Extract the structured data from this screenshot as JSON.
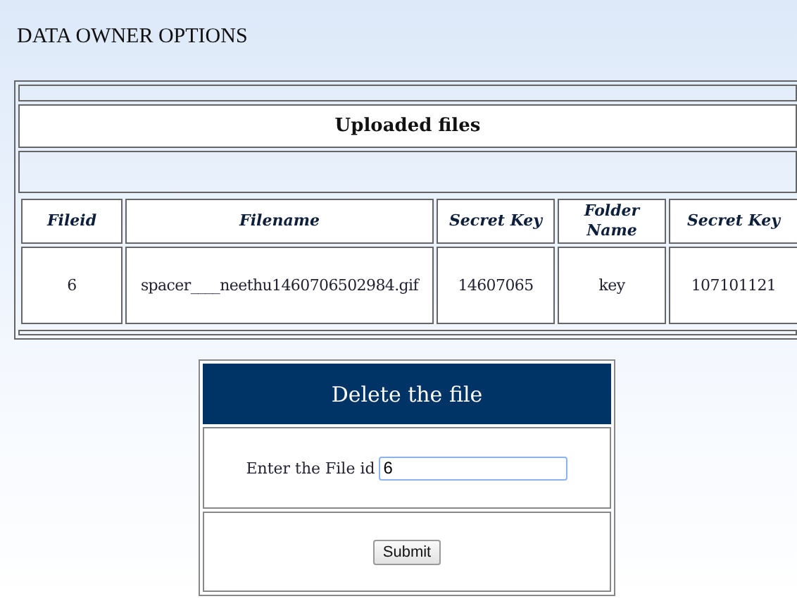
{
  "page_title": "DATA OWNER OPTIONS",
  "files_table": {
    "caption": "Uploaded files",
    "columns": [
      "Fileid",
      "Filename",
      "Secret Key",
      "Folder Name",
      "Secret Key"
    ],
    "rows": [
      [
        "6",
        "spacer____neethu1460706502984.gif",
        "14607065",
        "key",
        "107101121"
      ]
    ]
  },
  "delete_form": {
    "title": "Delete the file",
    "label": "Enter the File id",
    "value": "6",
    "submit": "Submit"
  }
}
